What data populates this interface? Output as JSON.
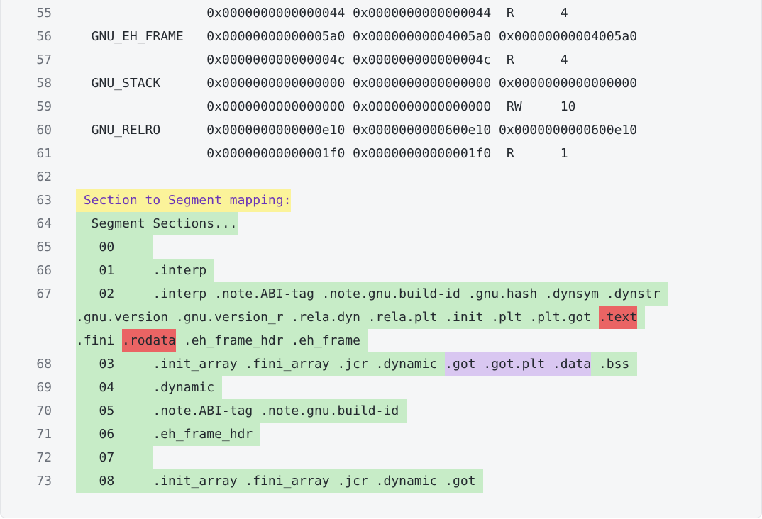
{
  "colors": {
    "panel_bg": "#f5f6f7",
    "line_number": "#6b7079",
    "text": "#24292f",
    "highlight_green": "#c7ecc7",
    "highlight_yellow": "#fbf39a",
    "highlight_yellow_text": "#6a35b8",
    "highlight_red": "#ea6464",
    "highlight_purple": "#d9c7f1"
  },
  "lines": [
    {
      "n": "55",
      "text": "                 0x0000000000000044 0x0000000000000044  R      4"
    },
    {
      "n": "56",
      "text": "  GNU_EH_FRAME   0x00000000000005a0 0x00000000004005a0 0x00000000004005a0"
    },
    {
      "n": "57",
      "text": "                 0x000000000000004c 0x000000000000004c  R      4"
    },
    {
      "n": "58",
      "text": "  GNU_STACK      0x0000000000000000 0x0000000000000000 0x0000000000000000"
    },
    {
      "n": "59",
      "text": "                 0x0000000000000000 0x0000000000000000  RW     10"
    },
    {
      "n": "60",
      "text": "  GNU_RELRO      0x0000000000000e10 0x0000000000600e10 0x0000000000600e10"
    },
    {
      "n": "61",
      "text": "                 0x00000000000001f0 0x00000000000001f0  R      1"
    },
    {
      "n": "62",
      "text": ""
    },
    {
      "n": "63",
      "segs": [
        {
          "t": " Section to Segment mapping:",
          "hl": "yellow"
        }
      ]
    },
    {
      "n": "64",
      "segs": [
        {
          "t": "  Segment Sections...",
          "hl": "green"
        }
      ]
    },
    {
      "n": "65",
      "segs": [
        {
          "t": "   00     ",
          "hl": "green"
        }
      ]
    },
    {
      "n": "66",
      "segs": [
        {
          "t": "   01     .interp ",
          "hl": "green"
        }
      ]
    },
    {
      "n": "67",
      "segs": [
        {
          "t": "   02     .interp .note.ABI-tag .note.gnu.build-id .gnu.hash .dynsym .dynstr ",
          "hl": "green"
        }
      ]
    },
    {
      "n": "",
      "segs": [
        {
          "t": ".gnu.version .gnu.version_r .rela.dyn .rela.plt .init .plt .plt.got ",
          "hl": "green"
        },
        {
          "t": ".text",
          "hl": "red"
        },
        {
          "t": " ",
          "hl": "green"
        }
      ]
    },
    {
      "n": "",
      "segs": [
        {
          "t": ".fini ",
          "hl": "green"
        },
        {
          "t": ".rodata",
          "hl": "red"
        },
        {
          "t": " .eh_frame_hdr .eh_frame ",
          "hl": "green"
        }
      ]
    },
    {
      "n": "68",
      "segs": [
        {
          "t": "   03     .init_array .fini_array .jcr .dynamic ",
          "hl": "green"
        },
        {
          "t": ".got .got.plt .data",
          "hl": "purple"
        },
        {
          "t": " .bss ",
          "hl": "green"
        }
      ]
    },
    {
      "n": "69",
      "segs": [
        {
          "t": "   04     .dynamic ",
          "hl": "green"
        }
      ]
    },
    {
      "n": "70",
      "segs": [
        {
          "t": "   05     .note.ABI-tag .note.gnu.build-id ",
          "hl": "green"
        }
      ]
    },
    {
      "n": "71",
      "segs": [
        {
          "t": "   06     .eh_frame_hdr ",
          "hl": "green"
        }
      ]
    },
    {
      "n": "72",
      "segs": [
        {
          "t": "   07     ",
          "hl": "green"
        }
      ]
    },
    {
      "n": "73",
      "segs": [
        {
          "t": "   08     .init_array .fini_array .jcr .dynamic .got ",
          "hl": "green"
        }
      ]
    }
  ]
}
